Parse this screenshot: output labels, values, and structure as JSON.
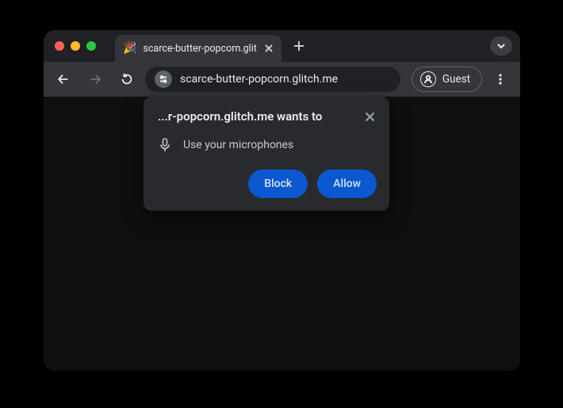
{
  "tab": {
    "favicon": "🎉",
    "title": "scarce-butter-popcorn.glitch"
  },
  "toolbar": {
    "url": "scarce-butter-popcorn.glitch.me",
    "guest_label": "Guest"
  },
  "permission": {
    "title": "...r-popcorn.glitch.me wants to",
    "item": "Use your microphones",
    "block_label": "Block",
    "allow_label": "Allow"
  }
}
